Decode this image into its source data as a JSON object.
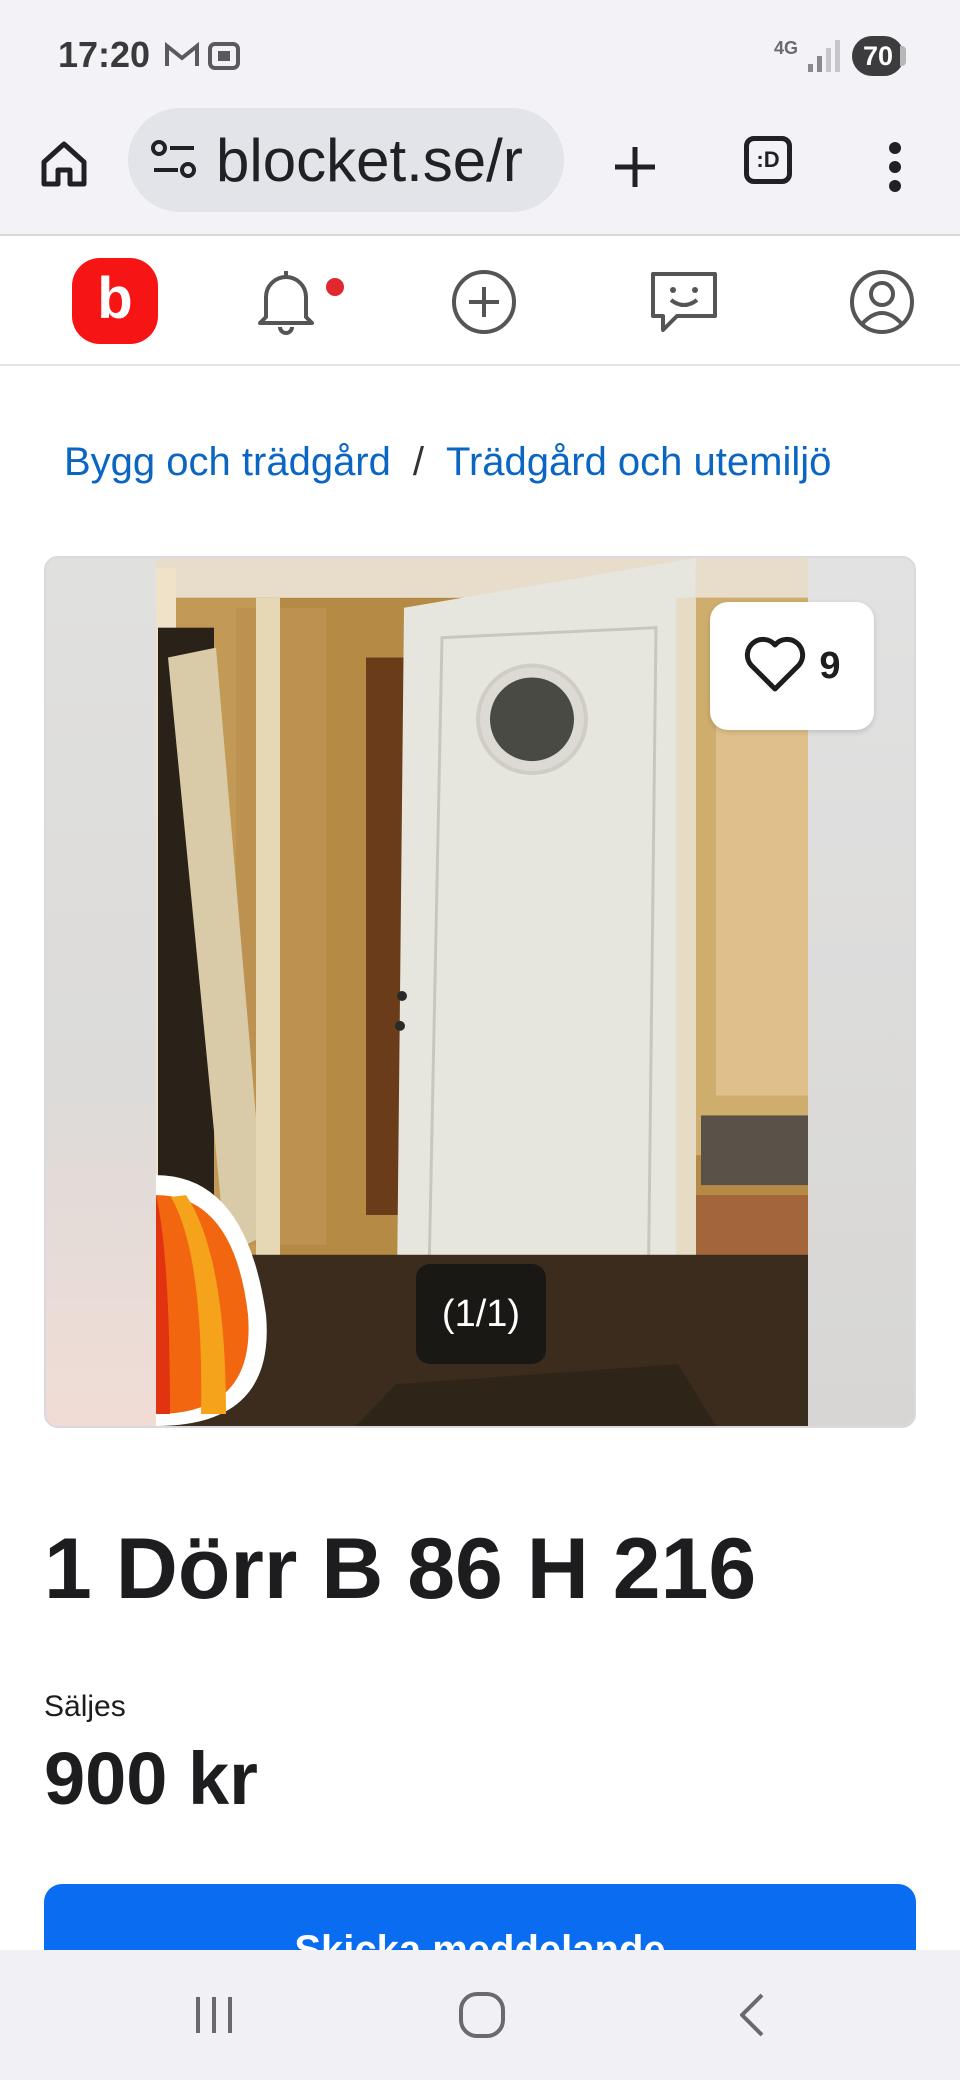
{
  "status_bar": {
    "time": "17:20",
    "network": "4G",
    "battery": "70"
  },
  "browser": {
    "url": "blocket.se/r",
    "tab_count": ":D"
  },
  "breadcrumb": {
    "items": [
      "Bygg och trädgård",
      "Trädgård och utemiljö"
    ],
    "separator": "/"
  },
  "gallery": {
    "favorite_count": "9",
    "image_counter": "(1/1)"
  },
  "listing": {
    "title": "1 Dörr B 86 H 216",
    "sale_type": "Säljes",
    "price": "900 kr",
    "cta_label": "Skicka meddelande"
  },
  "colors": {
    "brand_red": "#f71414",
    "link_blue": "#0a66c2",
    "cta_blue": "#0a6cf0"
  },
  "icons": [
    "gmail-icon",
    "screenshot-icon",
    "signal-icon",
    "home-icon",
    "site-settings-icon",
    "new-tab-icon",
    "overflow-menu-icon",
    "bell-icon",
    "add-listing-icon",
    "messages-icon",
    "profile-icon",
    "heart-icon",
    "recents-icon",
    "home-button-icon",
    "back-icon"
  ]
}
